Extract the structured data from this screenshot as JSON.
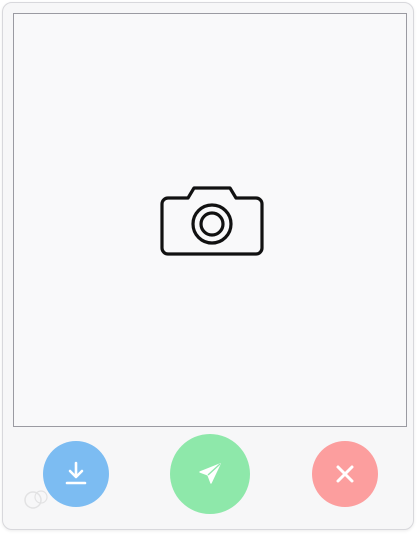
{
  "actions": {
    "download": {
      "icon": "download-icon",
      "color": "#7cbcf2"
    },
    "send": {
      "icon": "send-icon",
      "color": "#8ee8aa"
    },
    "cancel": {
      "icon": "close-icon",
      "color": "#fc9e9e"
    }
  },
  "preview": {
    "icon": "camera-icon"
  }
}
